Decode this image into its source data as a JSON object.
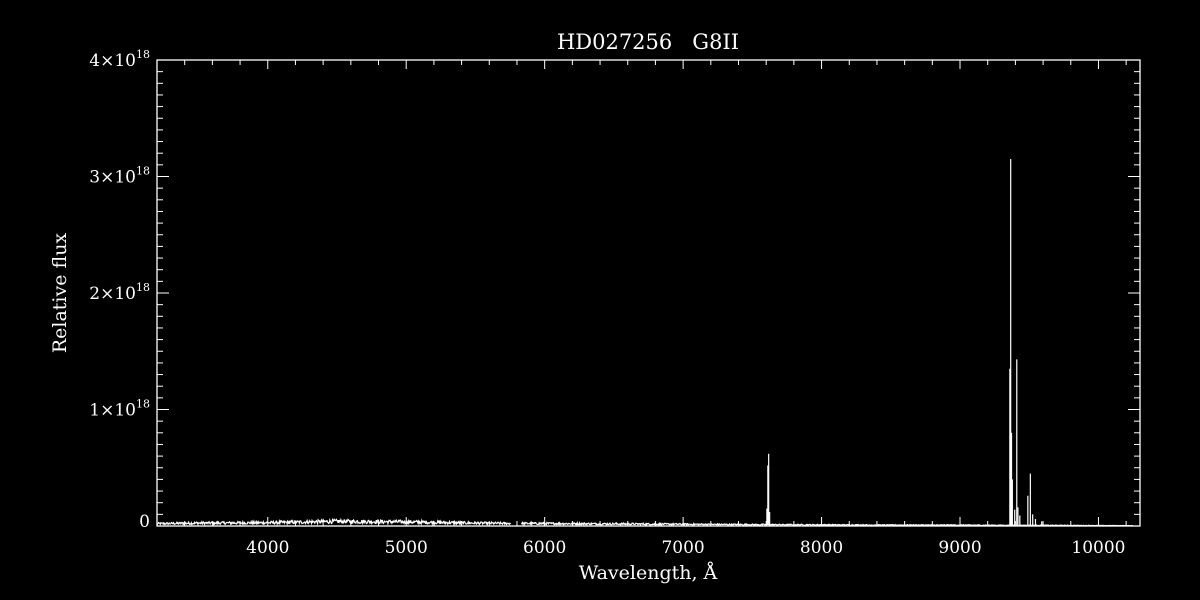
{
  "chart_data": {
    "type": "line",
    "title": "HD027256   G8II",
    "xlabel": "Wavelength, Å",
    "ylabel": "Relative flux",
    "xlim": [
      3200,
      10300
    ],
    "ylim": [
      0,
      4e+18
    ],
    "x_ticks": [
      4000,
      5000,
      6000,
      7000,
      8000,
      9000,
      10000
    ],
    "x_tick_labels": [
      "4000",
      "5000",
      "6000",
      "7000",
      "8000",
      "9000",
      "10000"
    ],
    "y_ticks": [
      {
        "value": 0,
        "mantissa": "0",
        "exponent": ""
      },
      {
        "value": 1e+18,
        "mantissa": "1×10",
        "exponent": "18"
      },
      {
        "value": 2e+18,
        "mantissa": "2×10",
        "exponent": "18"
      },
      {
        "value": 3e+18,
        "mantissa": "3×10",
        "exponent": "18"
      },
      {
        "value": 4e+18,
        "mantissa": "4×10",
        "exponent": "18"
      }
    ],
    "grid": false,
    "colors": {
      "background": "#000000",
      "foreground": "#ffffff"
    },
    "continuum": [
      [
        3200,
        2e+16
      ],
      [
        3500,
        2.5e+16
      ],
      [
        4000,
        2.8e+16
      ],
      [
        4300,
        3.5e+16
      ],
      [
        4500,
        4e+16
      ],
      [
        5000,
        3.5e+16
      ],
      [
        5500,
        2.5e+16
      ],
      [
        5750,
        2.2e+16
      ],
      [
        5850,
        2.2e+16
      ],
      [
        6200,
        2e+16
      ],
      [
        6500,
        1.8e+16
      ],
      [
        7000,
        1.5e+16
      ],
      [
        7500,
        1.2e+16
      ],
      [
        8000,
        1e+16
      ],
      [
        8500,
        8000000000000000.0
      ],
      [
        9000,
        8000000000000000.0
      ],
      [
        9300,
        6000000000000000.0
      ],
      [
        9600,
        6000000000000000.0
      ],
      [
        10000,
        4000000000000000.0
      ],
      [
        10250,
        3000000000000000.0
      ]
    ],
    "gaps": [
      [
        5760,
        5830
      ]
    ],
    "spikes": [
      [
        7605,
        1.5e+17
      ],
      [
        7612,
        5.2e+17
      ],
      [
        7618,
        6.2e+17
      ],
      [
        7625,
        1.2e+17
      ],
      [
        9360,
        1.35e+18
      ],
      [
        9366,
        3.15e+18
      ],
      [
        9372,
        8e+17
      ],
      [
        9378,
        4e+17
      ],
      [
        9395,
        1.4e+17
      ],
      [
        9410,
        1.43e+18
      ],
      [
        9418,
        1.6e+17
      ],
      [
        9432,
        9e+16
      ],
      [
        9490,
        2.6e+17
      ],
      [
        9508,
        4.5e+17
      ],
      [
        9525,
        1e+17
      ],
      [
        9545,
        6e+16
      ],
      [
        9590,
        4e+16
      ]
    ]
  }
}
